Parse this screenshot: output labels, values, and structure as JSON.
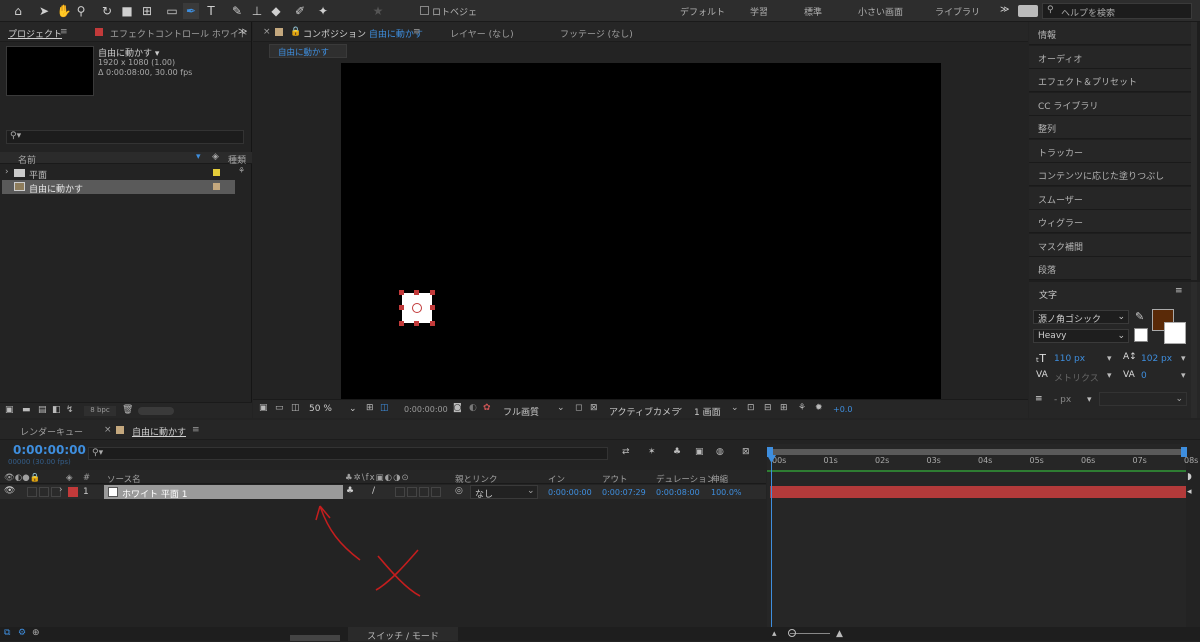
{
  "toolbar": {
    "roto_label": "ロトベジェ",
    "workspaces": [
      "デフォルト",
      "学習",
      "標準",
      "小さい画面",
      "ライブラリ"
    ],
    "more": "≫",
    "help_placeholder": "ヘルプを検索"
  },
  "project": {
    "tab_project": "プロジェクト",
    "tab_effects": "エフェクトコントロール ホワイト",
    "comp_name": "自由に動かす ▾",
    "comp_size": "1920 x 1080 (1.00)",
    "comp_duration": "Δ 0:00:08:00, 30.00 fps",
    "col_name": "名前",
    "col_type": "種類",
    "items": [
      {
        "label": "平面"
      },
      {
        "label": "自由に動かす"
      }
    ],
    "bpc": "8 bpc"
  },
  "viewer": {
    "tab_comp_prefix": "コンポジション",
    "tab_comp_name": "自由に動かす",
    "tab_layer": "レイヤー (なし)",
    "tab_footage": "フッテージ (なし)",
    "breadcrumb": "自由に動かす",
    "zoom": "50 %",
    "timecode": "0:00:00:00",
    "quality": "フル画質",
    "camera": "アクティブカメラ",
    "views": "1 画面",
    "exposure": "+0.0"
  },
  "right_panel": {
    "items": [
      "情報",
      "オーディオ",
      "エフェクト＆プリセット",
      "CC ライブラリ",
      "整列",
      "トラッカー",
      "コンテンツに応じた塗りつぶし",
      "スムーザー",
      "ウィグラー",
      "マスク補間",
      "段落"
    ],
    "char_title": "文字",
    "font_family": "源ノ角ゴシック",
    "font_style": "Heavy",
    "font_size": "110 px",
    "leading": "102 px",
    "kerning": "メトリクス",
    "tracking": "0",
    "stroke": "- px",
    "fill_color": "#5a2a08"
  },
  "timeline": {
    "tab_render": "レンダーキュー",
    "tab_comp": "自由に動かす",
    "timecode": "0:00:00:00",
    "timecode_sub": "00000 (30.00 fps)",
    "col_num": "#",
    "col_source": "ソース名",
    "col_parent": "親とリンク",
    "col_in": "イン",
    "col_out": "アウト",
    "col_duration": "デュレーション",
    "col_stretch": "伸縮",
    "layer": {
      "num": "1",
      "name": "ホワイト 平面 1",
      "parent": "なし",
      "in": "0:00:00:00",
      "out": "0:00:07:29",
      "duration": "0:00:08:00",
      "stretch": "100.0%",
      "label_color": "#c23a3a"
    },
    "ruler": [
      "00s",
      "01s",
      "02s",
      "03s",
      "04s",
      "05s",
      "06s",
      "07s",
      "08s"
    ],
    "switch_mode": "スイッチ / モード"
  }
}
